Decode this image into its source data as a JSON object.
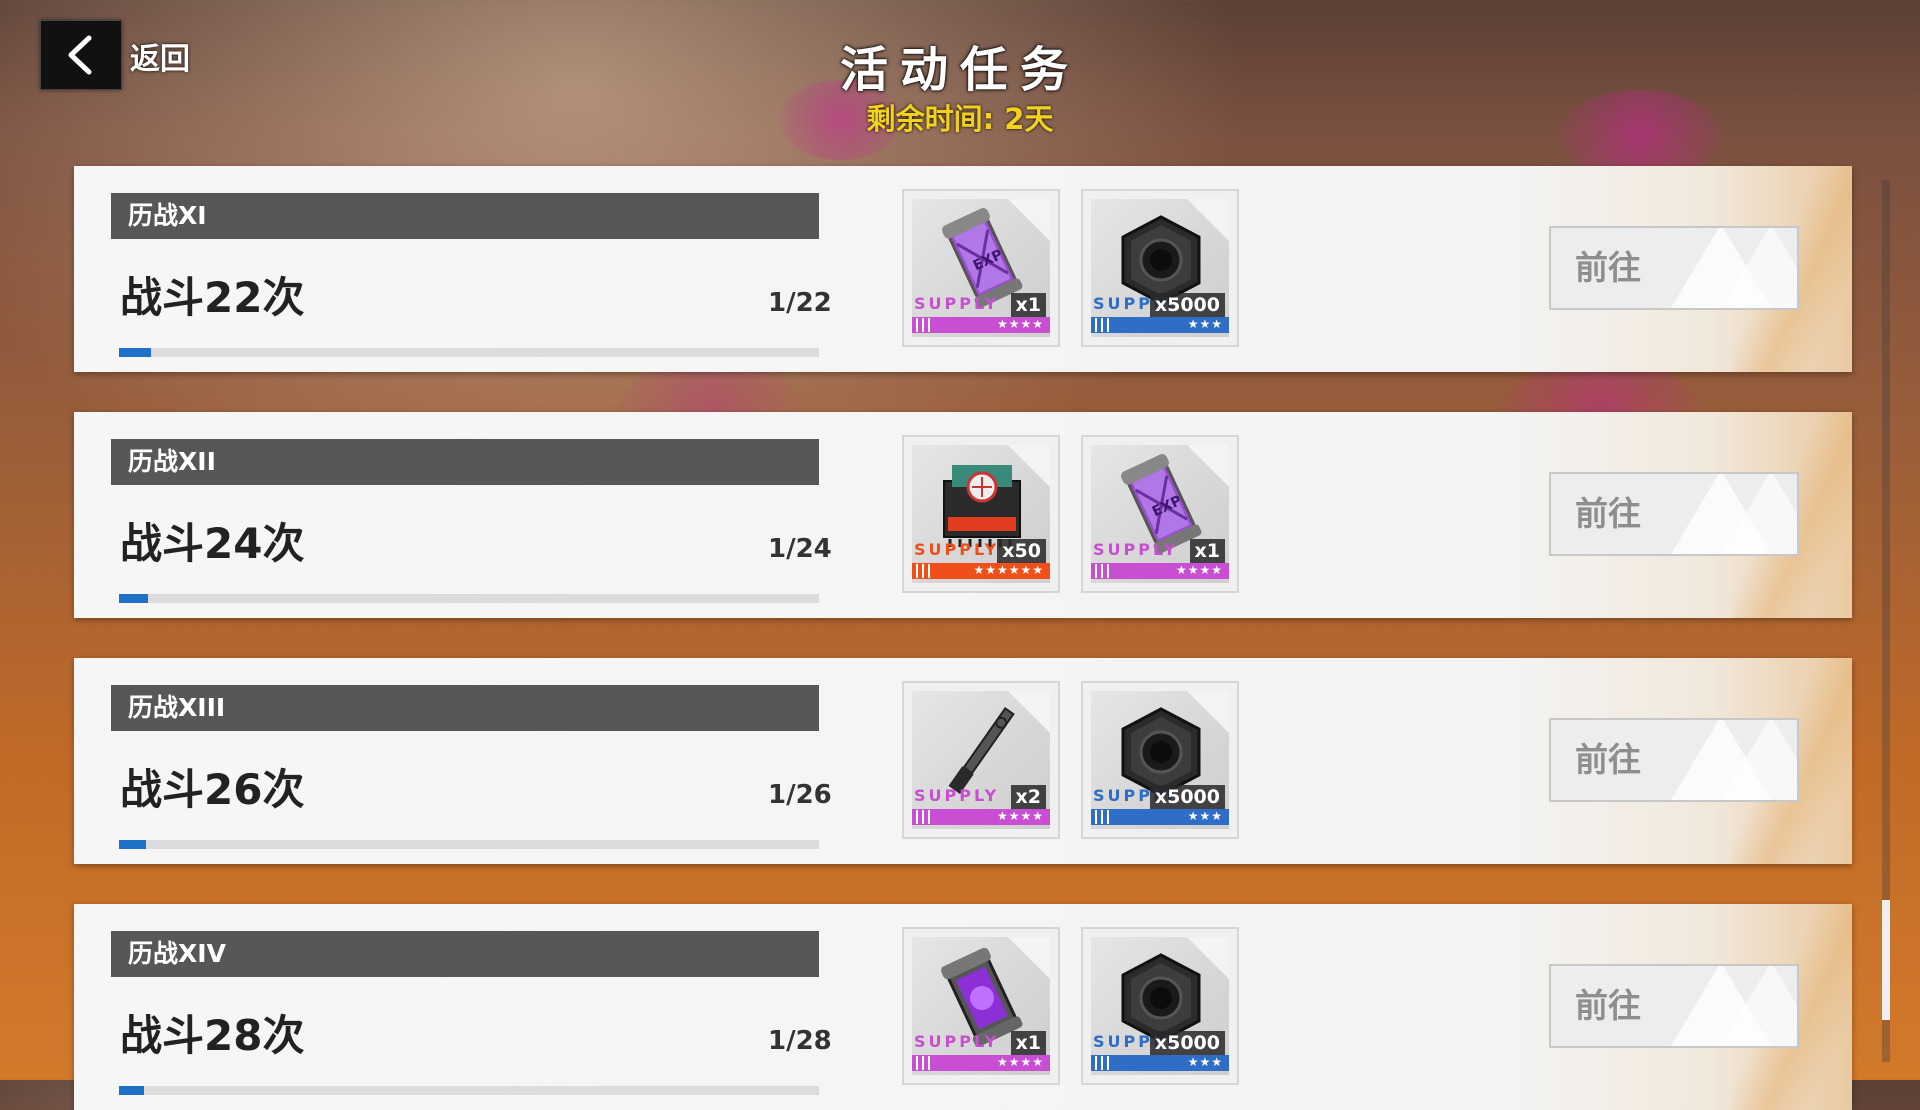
{
  "header": {
    "back_label": "返回",
    "title": "活动任务",
    "remaining": "剩余时间: 2天"
  },
  "quests": [
    {
      "label": "历战XI",
      "task": "战斗22次",
      "progress_text": "1/22",
      "progress": 0.045,
      "go_label": "前往",
      "rewards": [
        {
          "icon": "exp-capsule-icon",
          "supply": "SUPPLY",
          "qty": "x1",
          "stars": "★★★★",
          "color": "#c84fd2"
        },
        {
          "icon": "hex-nut-icon",
          "supply": "SUPPLY",
          "qty": "x5000",
          "stars": "★★★",
          "color": "#2f6ec6"
        }
      ]
    },
    {
      "label": "历战XII",
      "task": "战斗24次",
      "progress_text": "1/24",
      "progress": 0.042,
      "go_label": "前往",
      "rewards": [
        {
          "icon": "core-module-icon",
          "supply": "SUPPLY",
          "qty": "x50",
          "stars": "★★★★★★",
          "color": "#f04f1a"
        },
        {
          "icon": "exp-capsule-icon",
          "supply": "SUPPLY",
          "qty": "x1",
          "stars": "★★★★",
          "color": "#c84fd2"
        }
      ]
    },
    {
      "label": "历战XIII",
      "task": "战斗26次",
      "progress_text": "1/26",
      "progress": 0.038,
      "go_label": "前往",
      "rewards": [
        {
          "icon": "blade-icon",
          "supply": "SUPPLY",
          "qty": "x2",
          "stars": "★★★★",
          "color": "#c84fd2"
        },
        {
          "icon": "hex-nut-icon",
          "supply": "SUPPLY",
          "qty": "x5000",
          "stars": "★★★",
          "color": "#2f6ec6"
        }
      ]
    },
    {
      "label": "历战XIV",
      "task": "战斗28次",
      "progress_text": "1/28",
      "progress": 0.036,
      "go_label": "前往",
      "rewards": [
        {
          "icon": "energy-cell-icon",
          "supply": "SUPPLY",
          "qty": "x1",
          "stars": "★★★★",
          "color": "#c84fd2"
        },
        {
          "icon": "hex-nut-icon",
          "supply": "SUPPLY",
          "qty": "x5000",
          "stars": "★★★",
          "color": "#2f6ec6"
        }
      ]
    }
  ]
}
